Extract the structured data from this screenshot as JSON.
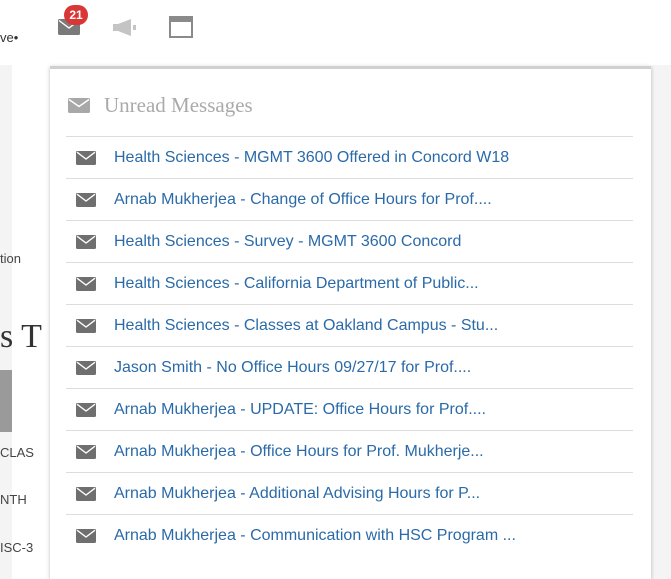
{
  "topbar": {
    "user_caret": "ve•",
    "notification_count": "21",
    "icons": {
      "mail": "envelope-icon",
      "announcements": "megaphone-icon",
      "window": "window-icon"
    }
  },
  "background_page": {
    "fragments": [
      "tion",
      "s T",
      "CLAS",
      "NTH",
      "ISC-3"
    ]
  },
  "dropdown": {
    "title": "Unread Messages",
    "messages": [
      {
        "text": "Health Sciences - MGMT 3600 Offered in Concord W18"
      },
      {
        "text": "Arnab Mukherjea - Change of Office Hours for Prof...."
      },
      {
        "text": "Health Sciences - Survey - MGMT 3600 Concord"
      },
      {
        "text": "Health Sciences - California Department of Public..."
      },
      {
        "text": "Health Sciences - Classes at Oakland Campus - Stu..."
      },
      {
        "text": "Jason Smith - No Office Hours 09/27/17 for Prof...."
      },
      {
        "text": "Arnab Mukherjea - UPDATE: Office Hours for Prof...."
      },
      {
        "text": "Arnab Mukherjea - Office Hours for Prof. Mukherje..."
      },
      {
        "text": "Arnab Mukherjea - Additional Advising Hours for P..."
      },
      {
        "text": "Arnab Mukherjea - Communication with HSC Program ..."
      }
    ]
  },
  "colors": {
    "badge": "#d93636",
    "link": "#2a6aa8",
    "title": "#aaaaaa",
    "icon": "#7a7a7a"
  }
}
